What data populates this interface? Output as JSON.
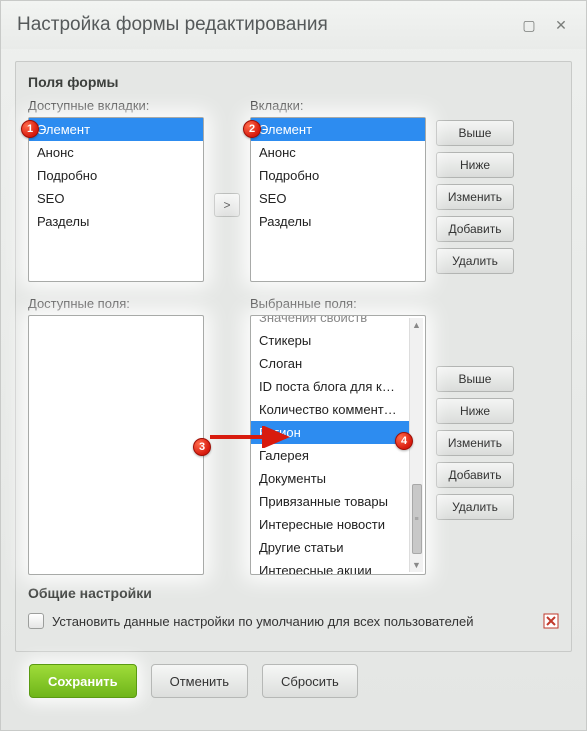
{
  "title": "Настройка формы редактирования",
  "section_fields": "Поля формы",
  "labels": {
    "available_tabs": "Доступные вкладки:",
    "tabs": "Вкладки:",
    "available_fields": "Доступные поля:",
    "selected_fields": "Выбранные поля:"
  },
  "tabs_available": [
    "Элемент",
    "Анонс",
    "Подробно",
    "SEO",
    "Разделы"
  ],
  "tabs_selected": [
    "Элемент",
    "Анонс",
    "Подробно",
    "SEO",
    "Разделы"
  ],
  "tabs_sel_index": 0,
  "fields_available": [],
  "fields_selected": [
    "Значения свойств",
    "Стикеры",
    "Слоган",
    "ID поста блога для комм",
    "Количество комментари",
    "Регион",
    "Галерея",
    "Документы",
    "Привязанные товары",
    "Интересные новости",
    "Другие статьи",
    "Интересные акции"
  ],
  "fields_sel_index": 5,
  "buttons": {
    "up": "Выше",
    "down": "Ниже",
    "edit": "Изменить",
    "add": "Добавить",
    "del": "Удалить",
    "save": "Сохранить",
    "cancel": "Отменить",
    "reset": "Сбросить",
    "move": ">"
  },
  "common_title": "Общие настройки",
  "common_checkbox": "Установить данные настройки по умолчанию для всех пользователей",
  "badges": {
    "b1": "1",
    "b2": "2",
    "b3": "3",
    "b4": "4"
  }
}
